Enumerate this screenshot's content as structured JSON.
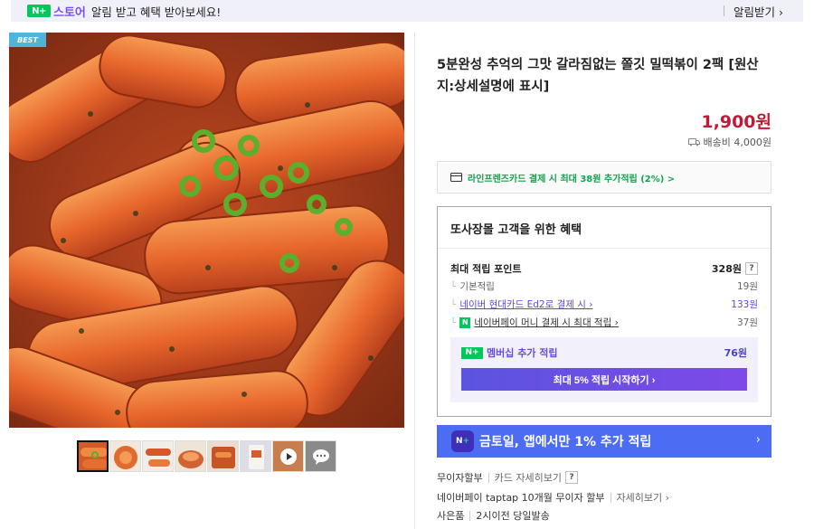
{
  "topbar": {
    "badge": "N+",
    "store_name": "스토어",
    "message": "알림 받고 혜택 받아보세요!",
    "alarm_button": "알림받기 ›"
  },
  "gallery": {
    "best_badge": "BEST",
    "thumbnails": [
      "thumb-1",
      "thumb-2",
      "thumb-3",
      "thumb-4",
      "thumb-5",
      "thumb-6",
      "thumb-video",
      "thumb-review"
    ]
  },
  "product": {
    "title": "5분완성 추억의 그맛 갈라짐없는 쫄깃 밀떡볶이 2팩 [원산지:상세설명에 표시]",
    "price": "1,900원",
    "shipping": "배송비 4,000원",
    "card_benefit": "라인프렌즈카드 결제 시 최대 38원 추가적립 (2%) >"
  },
  "benefit": {
    "title": "또사장몰 고객을 위한 혜택",
    "max_points_label": "최대 적립 포인트",
    "max_points_value": "328원",
    "help": "?",
    "rows": [
      {
        "label": "기본적립",
        "value": "19원"
      },
      {
        "label": "네이버 현대카드 Ed2로 결제 시 ›",
        "value": "133원"
      },
      {
        "label": "네이버페이 머니 결제 시 최대 적립 ›",
        "value": "37원"
      }
    ],
    "membership_label": "멤버십 추가 적립",
    "membership_value": "76원",
    "membership_button": "최대 5% 적립 시작하기 ›"
  },
  "promo": {
    "text": "금토일, 앱에서만 1% 추가 적립",
    "arrow": "›"
  },
  "payment": {
    "installment": "무이자할부",
    "card_detail": "카드 자세히보기",
    "taptap": "네이버페이 taptap 10개월 무이자 할부",
    "detail": "자세히보기 ›",
    "gift": "사은품",
    "dispatch": "2시이전 당일발송"
  },
  "colors": {
    "price": "#c01a36",
    "brand_green": "#03c75a",
    "promo_blue": "#4b6cf3"
  }
}
